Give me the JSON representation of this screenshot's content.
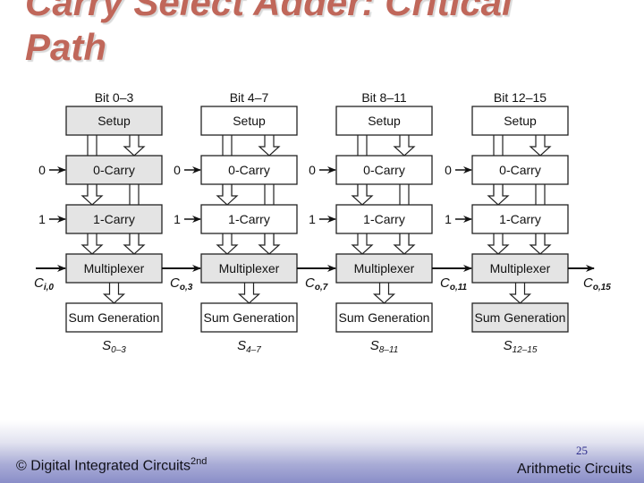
{
  "slide": {
    "title_line1": "Carry Select Adder: Critical",
    "title_line2": "Path",
    "accent_color": "#c0675a"
  },
  "diagram": {
    "columns": [
      {
        "bit_label": "Bit 0–3",
        "setup": "Setup",
        "carry0": "0-Carry",
        "carry1": "1-Carry",
        "mux": "Multiplexer",
        "sum": "Sum Generation",
        "sum_out": "S",
        "sum_sub": "0–3",
        "critical": {
          "setup": true,
          "carry0": true,
          "carry1": true,
          "mux": true,
          "sum": false
        }
      },
      {
        "bit_label": "Bit 4–7",
        "setup": "Setup",
        "carry0": "0-Carry",
        "carry1": "1-Carry",
        "mux": "Multiplexer",
        "sum": "Sum Generation",
        "sum_out": "S",
        "sum_sub": "4–7",
        "critical": {
          "setup": false,
          "carry0": false,
          "carry1": false,
          "mux": true,
          "sum": false
        }
      },
      {
        "bit_label": "Bit 8–11",
        "setup": "Setup",
        "carry0": "0-Carry",
        "carry1": "1-Carry",
        "mux": "Multiplexer",
        "sum": "Sum Generation",
        "sum_out": "S",
        "sum_sub": "8–11",
        "critical": {
          "setup": false,
          "carry0": false,
          "carry1": false,
          "mux": true,
          "sum": false
        }
      },
      {
        "bit_label": "Bit 12–15",
        "setup": "Setup",
        "carry0": "0-Carry",
        "carry1": "1-Carry",
        "mux": "Multiplexer",
        "sum": "Sum Generation",
        "sum_out": "S",
        "sum_sub": "12–15",
        "critical": {
          "setup": false,
          "carry0": false,
          "carry1": false,
          "mux": true,
          "sum": true
        }
      }
    ],
    "carry_in_0": "0",
    "carry_in_1": "1",
    "carry_signals": [
      {
        "main": "C",
        "sub": "i,0"
      },
      {
        "main": "C",
        "sub": "o,3"
      },
      {
        "main": "C",
        "sub": "o,7"
      },
      {
        "main": "C",
        "sub": "o,11"
      },
      {
        "main": "C",
        "sub": "o,15"
      }
    ],
    "critical_fill": "#e4e4e4",
    "normal_fill": "#ffffff"
  },
  "footer": {
    "copyright": "© Digital Integrated Circuits",
    "edition": "2nd",
    "page_number": "25",
    "section": "Arithmetic Circuits"
  }
}
